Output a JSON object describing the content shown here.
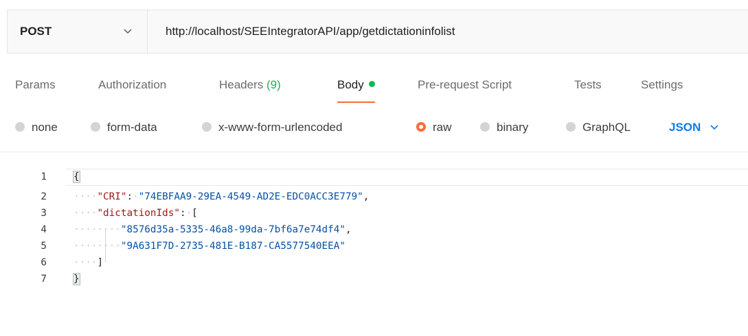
{
  "request": {
    "method": "POST",
    "url": "http://localhost/SEEIntegratorAPI/app/getdictationinfolist"
  },
  "tabs": [
    {
      "label": "Params"
    },
    {
      "label": "Authorization"
    },
    {
      "label": "Headers",
      "count": "(9)"
    },
    {
      "label": "Body",
      "active": true
    },
    {
      "label": "Pre-request Script"
    },
    {
      "label": "Tests"
    },
    {
      "label": "Settings"
    }
  ],
  "body_types": [
    {
      "label": "none"
    },
    {
      "label": "form-data"
    },
    {
      "label": "x-www-form-urlencoded"
    },
    {
      "label": "raw",
      "selected": true
    },
    {
      "label": "binary"
    },
    {
      "label": "GraphQL"
    }
  ],
  "language": "JSON",
  "editor": {
    "line_numbers": [
      "1",
      "2",
      "3",
      "4",
      "5",
      "6",
      "7"
    ],
    "open_brace": "{",
    "key_cri": "\"CRI\"",
    "val_cri": "\"74EBFAA9-29EA-4549-AD2E-EDC0ACC3E779\"",
    "key_ids": "\"dictationIds\"",
    "open_bracket": "[",
    "id_1": "\"8576d35a-5335-46a8-99da-7bf6a7e74df4\"",
    "id_2": "\"9A631F7D-2735-481E-B187-CA5577540EEA\"",
    "close_bracket": "]",
    "close_brace": "}",
    "colon": ":",
    "comma": ","
  },
  "colors": {
    "accent": "#ff6c37",
    "green_dot": "#0cbb52",
    "link_blue": "#097bed"
  }
}
